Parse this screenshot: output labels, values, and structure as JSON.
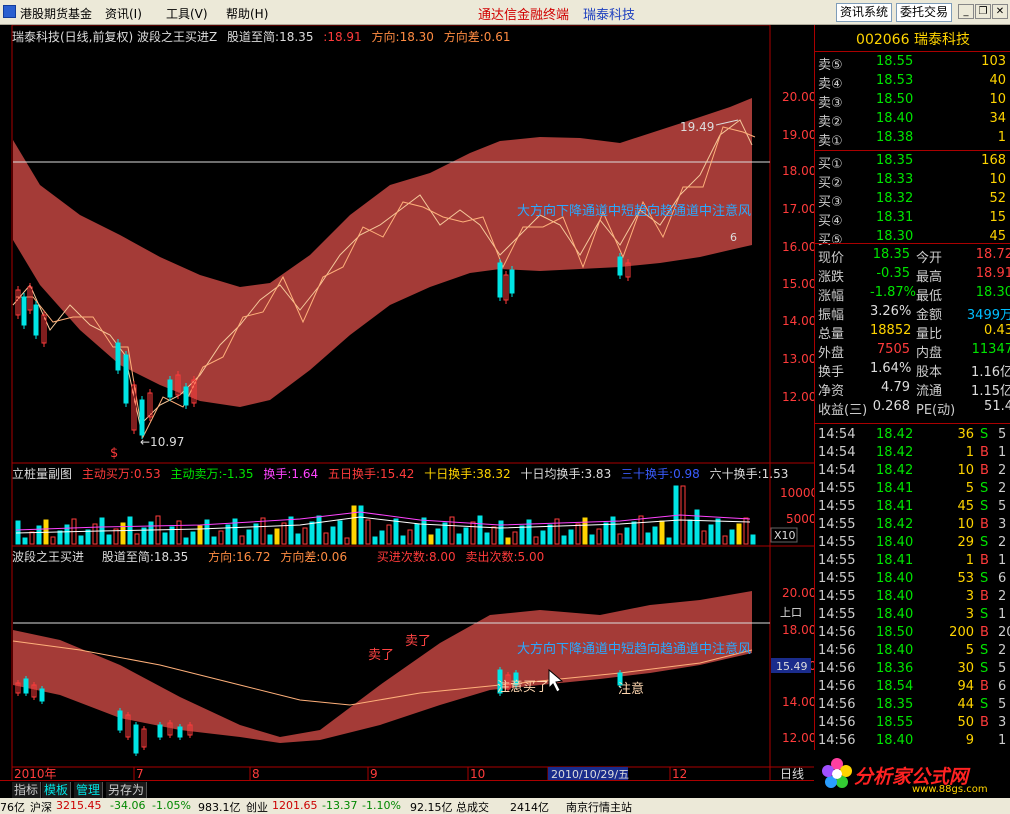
{
  "menu": {
    "items": [
      "港股期货基金",
      "资讯(I)",
      "工具(V)",
      "帮助(H)"
    ],
    "center_left": "通达信金融终端",
    "center_right": "瑞泰科技",
    "btn_news": "资讯系统",
    "btn_trade": "委托交易"
  },
  "main_header": {
    "title": "瑞泰科技(日线,前复权) 波段之王买进Z",
    "f1_label": "股道至简:",
    "f1_val": "18.35",
    "f2_val": ":18.91",
    "f3_label": "方向:",
    "f3_val": "18.30",
    "f4_label": "方向差:",
    "f4_val": "0.61"
  },
  "main_axis": [
    "20.00",
    "19.00",
    "18.00",
    "17.00",
    "16.00",
    "15.00",
    "14.00",
    "13.00",
    "12.00"
  ],
  "main_annot": {
    "high": "19.49",
    "low": "←10.97",
    "text": "大方向下降通道中短趋向趋通道中注意风",
    "marker": "$",
    "small": "6"
  },
  "vol_header": {
    "title": "立桩量副图",
    "a_label": "主动买万:",
    "a_val": "0.53",
    "b_label": "主动卖万:",
    "b_val": "-1.35",
    "c_label": "换手:",
    "c_val": "1.64",
    "d_label": "五日换手:",
    "d_val": "15.42",
    "e_label": "十日换手:",
    "e_val": "38.32",
    "f_label": "十日均换手:",
    "f_val": "3.83",
    "g_label": "三十换手:",
    "g_val": "0.98",
    "h_label": "六十换手:",
    "h_val": "1.53"
  },
  "vol_axis": [
    "10000",
    "5000",
    "X10"
  ],
  "sub_header": {
    "title": "波段之王买进",
    "a_label": "股道至简:",
    "a_val": "18.35",
    "b_label": "方向:",
    "b_val": "16.72",
    "c_label": "方向差:",
    "c_val": "0.06",
    "d_label": "买进次数:",
    "d_val": "8.00",
    "e_label": "卖出次数:",
    "e_val": "5.00"
  },
  "sub_axis": [
    "20.00",
    "18.00",
    "16.00",
    "14.00",
    "12.00"
  ],
  "sub_annot": {
    "sell1": "卖了",
    "sell2": "卖了",
    "buy1": "注意买了",
    "buy2": "注意",
    "text": "大方向下降通道中短趋向趋通道中注意风",
    "price_tag": "15.49",
    "side_tag": "上口"
  },
  "xaxis": {
    "labels": [
      "2010年",
      "7",
      "8",
      "9",
      "10",
      "11",
      "12"
    ],
    "cursor_date": "2010/10/29/五",
    "period": "日线"
  },
  "tabs": [
    "指标",
    "模板",
    "管理",
    "另存为"
  ],
  "panel": {
    "title": "002066 瑞泰科技",
    "sells": [
      {
        "label": "卖⑤",
        "price": "18.55",
        "vol": "103"
      },
      {
        "label": "卖④",
        "price": "18.53",
        "vol": "40"
      },
      {
        "label": "卖③",
        "price": "18.50",
        "vol": "10"
      },
      {
        "label": "卖②",
        "price": "18.40",
        "vol": "34"
      },
      {
        "label": "卖①",
        "price": "18.38",
        "vol": "1"
      }
    ],
    "buys": [
      {
        "label": "买①",
        "price": "18.35",
        "vol": "168"
      },
      {
        "label": "买②",
        "price": "18.33",
        "vol": "10"
      },
      {
        "label": "买③",
        "price": "18.32",
        "vol": "52"
      },
      {
        "label": "买④",
        "price": "18.31",
        "vol": "15"
      },
      {
        "label": "买⑤",
        "price": "18.30",
        "vol": "45"
      }
    ],
    "stats": [
      {
        "a": "现价",
        "b": "18.35",
        "bc": "green",
        "c": "今开",
        "d": "18.72",
        "dc": "red"
      },
      {
        "a": "涨跌",
        "b": "-0.35",
        "bc": "green",
        "c": "最高",
        "d": "18.91",
        "dc": "red"
      },
      {
        "a": "涨幅",
        "b": "-1.87%",
        "bc": "green",
        "c": "最低",
        "d": "18.30",
        "dc": "green"
      },
      {
        "a": "振幅",
        "b": "3.26%",
        "bc": "white",
        "c": "金额",
        "d": "3499万",
        "dc": "blue"
      },
      {
        "a": "总量",
        "b": "18852",
        "bc": "yellow",
        "c": "量比",
        "d": "0.43",
        "dc": "yellow"
      },
      {
        "a": "外盘",
        "b": "7505",
        "bc": "red",
        "c": "内盘",
        "d": "11347",
        "dc": "green"
      },
      {
        "a": "换手",
        "b": "1.64%",
        "bc": "white",
        "c": "股本",
        "d": "1.16亿",
        "dc": "white"
      },
      {
        "a": "净资",
        "b": "4.79",
        "bc": "white",
        "c": "流通",
        "d": "1.15亿",
        "dc": "white"
      },
      {
        "a": "收益(三)",
        "b": "0.268",
        "bc": "white",
        "c": "PE(动)",
        "d": "51.4",
        "dc": "white"
      }
    ],
    "ticks": [
      {
        "t": "14:54",
        "p": "18.42",
        "pc": "green",
        "v": "36",
        "bs": "S",
        "n": "5"
      },
      {
        "t": "14:54",
        "p": "18.42",
        "pc": "green",
        "v": "1",
        "bs": "B",
        "n": "1"
      },
      {
        "t": "14:54",
        "p": "18.42",
        "pc": "green",
        "v": "10",
        "bs": "B",
        "n": "2"
      },
      {
        "t": "14:55",
        "p": "18.41",
        "pc": "green",
        "v": "5",
        "bs": "S",
        "n": "2"
      },
      {
        "t": "14:55",
        "p": "18.41",
        "pc": "green",
        "v": "45",
        "bs": "S",
        "n": "5"
      },
      {
        "t": "14:55",
        "p": "18.42",
        "pc": "green",
        "v": "10",
        "bs": "B",
        "n": "3"
      },
      {
        "t": "14:55",
        "p": "18.40",
        "pc": "green",
        "v": "29",
        "bs": "S",
        "n": "2"
      },
      {
        "t": "14:55",
        "p": "18.41",
        "pc": "green",
        "v": "1",
        "bs": "B",
        "n": "1"
      },
      {
        "t": "14:55",
        "p": "18.40",
        "pc": "green",
        "v": "53",
        "bs": "S",
        "n": "6"
      },
      {
        "t": "14:55",
        "p": "18.40",
        "pc": "green",
        "v": "3",
        "bs": "B",
        "n": "2"
      },
      {
        "t": "14:55",
        "p": "18.40",
        "pc": "green",
        "v": "3",
        "bs": "S",
        "n": "1"
      },
      {
        "t": "14:56",
        "p": "18.50",
        "pc": "green",
        "v": "200",
        "bs": "B",
        "n": "20"
      },
      {
        "t": "14:56",
        "p": "18.40",
        "pc": "green",
        "v": "5",
        "bs": "S",
        "n": "2"
      },
      {
        "t": "14:56",
        "p": "18.36",
        "pc": "green",
        "v": "30",
        "bs": "S",
        "n": "5"
      },
      {
        "t": "14:56",
        "p": "18.54",
        "pc": "green",
        "v": "94",
        "bs": "B",
        "n": "6"
      },
      {
        "t": "14:56",
        "p": "18.35",
        "pc": "green",
        "v": "44",
        "bs": "S",
        "n": "5"
      },
      {
        "t": "14:56",
        "p": "18.55",
        "pc": "green",
        "v": "50",
        "bs": "B",
        "n": "3"
      },
      {
        "t": "14:56",
        "p": "18.40",
        "pc": "green",
        "v": "9",
        "bs": "",
        "n": "1"
      }
    ]
  },
  "status": {
    "s0": "76亿",
    "s1_label": "沪深",
    "s1_val": "3215.45",
    "s1_chg": "-34.06",
    "s1_pct": "-1.05%",
    "s1_amt": "983.1亿",
    "s2_label": "创业",
    "s2_val": "1201.65",
    "s2_chg": "-13.37",
    "s2_pct": "-1.10%",
    "s2_amt": "92.15亿",
    "s3": "总成交",
    "s4": "2414亿",
    "s5": "南京行情主站"
  },
  "logo": {
    "brand": "分析家公式网",
    "url": "www.88gs.com"
  },
  "colors": {
    "band": "#a43b37",
    "up": "#ff3b3b",
    "down": "#00e5e5",
    "line": "#f5c89a",
    "border": "#aa0000"
  }
}
